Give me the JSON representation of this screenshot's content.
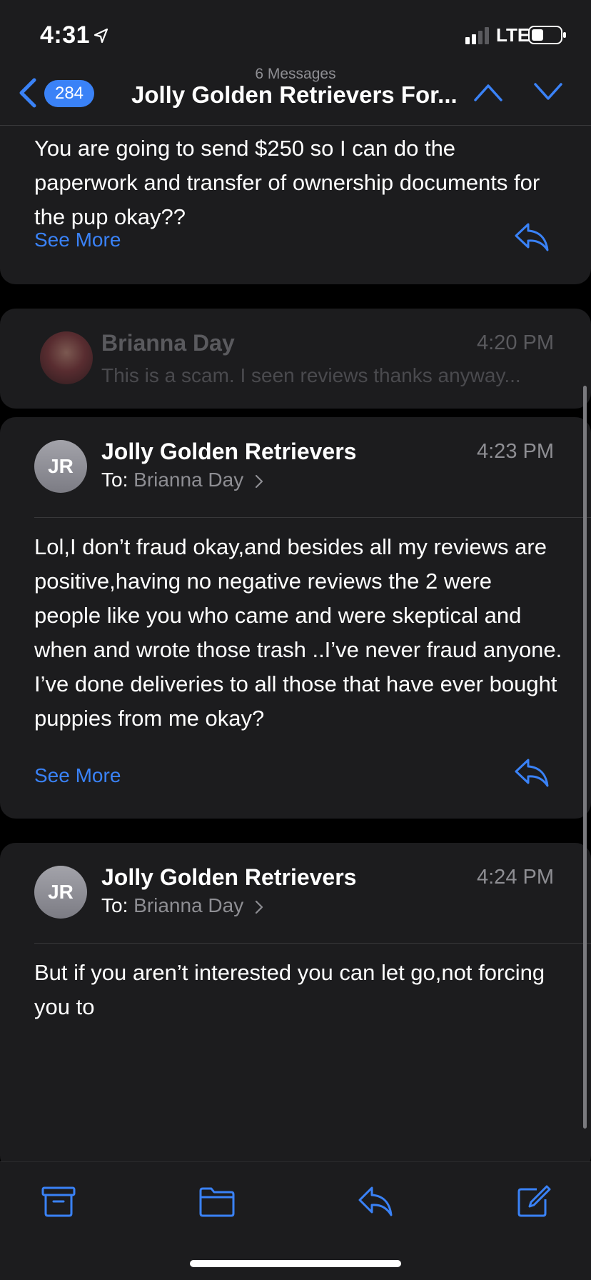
{
  "status_bar": {
    "time": "4:31",
    "network": "LTE"
  },
  "nav": {
    "unread_count": "284",
    "message_count": "6 Messages",
    "title": "Jolly Golden Retrievers For..."
  },
  "messages": [
    {
      "body": "You are going to send $250 so I can do the paperwork and transfer of ownership documents for the pup okay??",
      "see_more": "See More"
    },
    {
      "sender": "Brianna Day",
      "time": "4:20 PM",
      "preview": "This is a scam. I seen reviews thanks anyway..."
    },
    {
      "avatar_initials": "JR",
      "sender": "Jolly Golden Retrievers",
      "to_label": "To:",
      "recipient": "Brianna Day",
      "time": "4:23 PM",
      "body": "Lol,I don’t fraud okay,and besides all my reviews are positive,having no negative reviews the 2 were people like you who came and were skeptical and when and wrote those trash ..I’ve never fraud anyone. I’ve done deliveries to all those that have ever bought puppies from me okay?",
      "see_more": "See More"
    },
    {
      "avatar_initials": "JR",
      "sender": "Jolly Golden Retrievers",
      "to_label": "To:",
      "recipient": "Brianna Day",
      "time": "4:24 PM",
      "body": "But if you aren’t interested you can let go,not forcing you to"
    }
  ],
  "colors": {
    "accent": "#3a82f7",
    "card": "#1c1c1e",
    "secondary_text": "#8e8e93"
  },
  "toolbar": {
    "icons": [
      "archive-icon",
      "folder-icon",
      "reply-icon",
      "compose-icon"
    ]
  }
}
